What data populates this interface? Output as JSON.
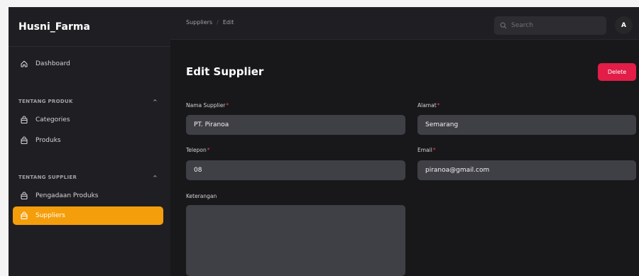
{
  "app": {
    "title": "Husni_Farma"
  },
  "sidebar": {
    "dashboard": {
      "label": "Dashboard",
      "icon": "home-icon"
    },
    "groups": [
      {
        "label": "TENTANG PRODUK",
        "items": [
          {
            "label": "Categories",
            "icon": "bag-icon"
          },
          {
            "label": "Produks",
            "icon": "bag-icon"
          }
        ]
      },
      {
        "label": "TENTANG SUPPLIER",
        "items": [
          {
            "label": "Pengadaan Produks",
            "icon": "bag-icon"
          },
          {
            "label": "Suppliers",
            "icon": "bag-icon",
            "active": true
          }
        ]
      }
    ]
  },
  "topbar": {
    "breadcrumb": [
      "Suppliers",
      "Edit"
    ],
    "search": {
      "placeholder": "Search"
    },
    "avatar": "A"
  },
  "page": {
    "title": "Edit Supplier",
    "delete_label": "Delete"
  },
  "form": {
    "nama_supplier": {
      "label": "Nama Supplier",
      "value": "PT. Piranoa",
      "required": true
    },
    "alamat": {
      "label": "Alamat",
      "value": "Semarang",
      "required": true
    },
    "telepon": {
      "label": "Telepon",
      "value": "08",
      "required": true
    },
    "email": {
      "label": "Email",
      "value": "piranoa@gmail.com",
      "required": true
    },
    "keterangan": {
      "label": "Keterangan",
      "value": ""
    }
  },
  "colors": {
    "accent": "#f59e0b",
    "danger": "#e11d48",
    "required": "#ef4444"
  }
}
